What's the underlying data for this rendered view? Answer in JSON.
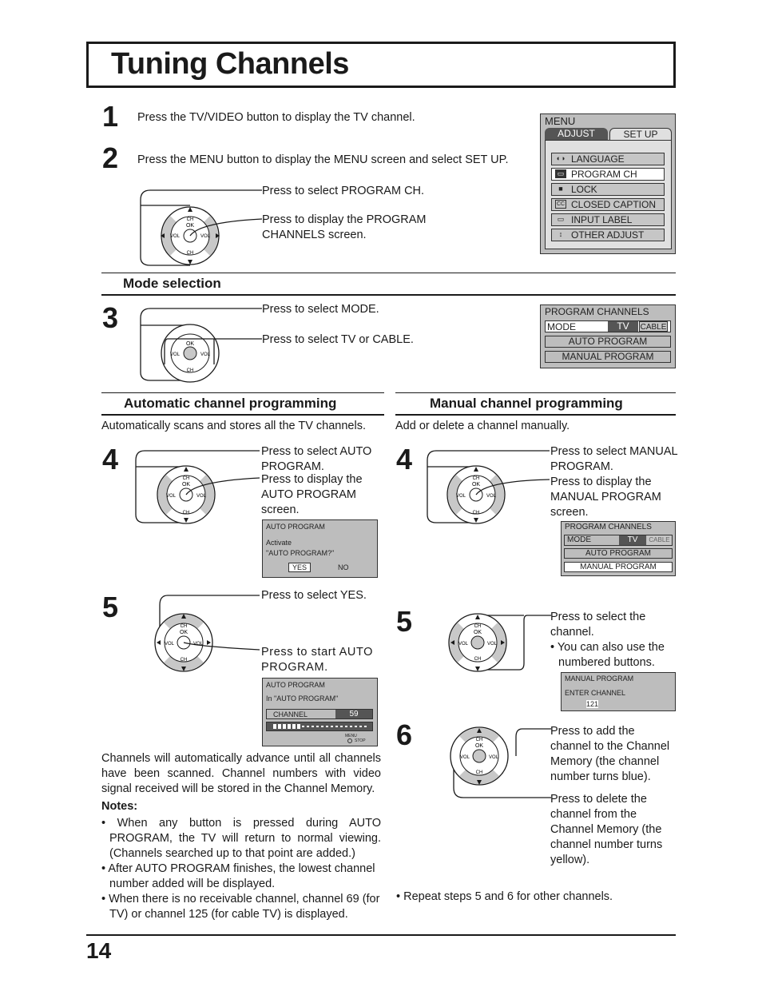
{
  "page": {
    "title": "Tuning Channels",
    "page_number": "14"
  },
  "steps_top": [
    {
      "num": "1",
      "text": "Press the TV/VIDEO button to display the TV channel."
    },
    {
      "num": "2",
      "text": "Press the MENU button to display the MENU screen and select SET UP."
    }
  ],
  "step2_callouts": {
    "select": "Press to select PROGRAM CH.",
    "display": "Press to display the PROGRAM CHANNELS screen."
  },
  "menu_osd": {
    "title": "MENU",
    "tabs": [
      {
        "label": "ADJUST",
        "active": false
      },
      {
        "label": "SET  UP",
        "active": true
      }
    ],
    "items": [
      {
        "icon": "language-icon",
        "glyph": "◐",
        "label": "LANGUAGE",
        "selected": false
      },
      {
        "icon": "program-ch-icon",
        "glyph": "▭",
        "label": "PROGRAM  CH",
        "selected": true
      },
      {
        "icon": "lock-icon",
        "glyph": "🔒",
        "label": "LOCK",
        "selected": false
      },
      {
        "icon": "closed-caption-icon",
        "glyph": "CC",
        "label": "CLOSED  CAPTION",
        "selected": false
      },
      {
        "icon": "input-label-icon",
        "glyph": "▭",
        "label": "INPUT  LABEL",
        "selected": false
      },
      {
        "icon": "other-adjust-icon",
        "glyph": "↕",
        "label": "OTHER  ADJUST",
        "selected": false
      }
    ]
  },
  "dial": {
    "ch": "CH",
    "ok": "OK",
    "vol": "VOL"
  },
  "mode_section": {
    "heading": "Mode selection",
    "step_num": "3",
    "callout_mode": "Press to select MODE.",
    "callout_tv_cable": "Press to select TV or CABLE."
  },
  "program_channels_osd": {
    "title": "PROGRAM  CHANNELS",
    "mode_label": "MODE",
    "mode_tv": "TV",
    "mode_cable": "CABLE",
    "auto_program": "AUTO  PROGRAM",
    "manual_program": "MANUAL  PROGRAM"
  },
  "auto_section": {
    "heading": "Automatic channel programming",
    "intro": "Automatically scans and stores all the TV channels.",
    "step4_num": "4",
    "step4_select": "Press to select AUTO PROGRAM.",
    "step4_display": "Press to display the AUTO PROGRAM screen.",
    "auto_osd1": {
      "title": "AUTO  PROGRAM",
      "line1": "Activate",
      "line2": "\"AUTO  PROGRAM?\"",
      "yes": "YES",
      "no": "NO"
    },
    "step5_num": "5",
    "step5_select": "Press to select YES.",
    "step5_start": "Press to start AUTO PROGRAM.",
    "auto_osd2": {
      "title": "AUTO  PROGRAM",
      "status": "In  \"AUTO  PROGRAM\"",
      "channel_label": "CHANNEL",
      "channel_value": "59",
      "progress_fraction": 0.3,
      "menu_label": "MENU",
      "stop_label": "STOP"
    },
    "paragraph": "Channels will automatically advance until all channels have been scanned. Channel numbers with video signal received will be stored in the Channel Memory.",
    "notes_heading": "Notes:",
    "notes": [
      "When any button is pressed during AUTO PROGRAM, the TV will return to normal viewing. (Channels searched up to that point are added.)",
      "After AUTO PROGRAM finishes, the lowest channel number added will be displayed.",
      "When there is no receivable channel, channel 69 (for TV) or channel 125 (for cable TV) is displayed."
    ]
  },
  "manual_section": {
    "heading": "Manual channel programming",
    "intro": "Add or delete a channel manually.",
    "step4_num": "4",
    "step4_select": "Press to select MANUAL PROGRAM.",
    "step4_display": "Press to display the MANUAL PROGRAM screen.",
    "pc_osd": {
      "title": "PROGRAM  CHANNELS",
      "mode_label": "MODE",
      "mode_tv": "TV",
      "mode_cable": "CABLE",
      "auto_program": "AUTO  PROGRAM",
      "manual_program": "MANUAL  PROGRAM"
    },
    "step5_num": "5",
    "step5_select": "Press to select the channel.",
    "step5_note": "You can also use the numbered buttons.",
    "manual_osd": {
      "title": "MANUAL  PROGRAM",
      "prompt": "ENTER  CHANNEL",
      "value": "121"
    },
    "step6_num": "6",
    "step6_add": "Press to add the channel to the Channel Memory (the channel number turns blue).",
    "step6_delete": "Press to delete the channel from the Channel Memory (the channel number turns yellow).",
    "repeat_note": "Repeat steps 5 and 6 for other channels."
  }
}
